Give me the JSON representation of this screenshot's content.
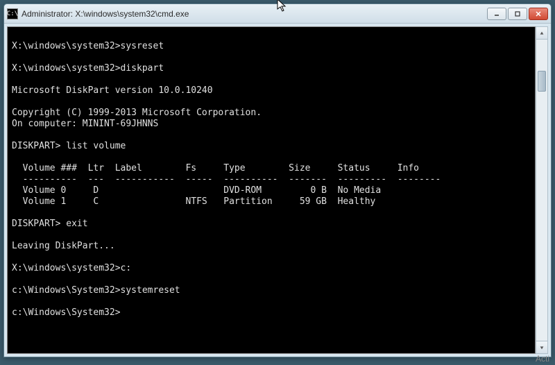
{
  "window": {
    "title": "Administrator: X:\\windows\\system32\\cmd.exe",
    "icon_label": "C:\\"
  },
  "console": {
    "lines": [
      "",
      "X:\\windows\\system32>sysreset",
      "",
      "X:\\windows\\system32>diskpart",
      "",
      "Microsoft DiskPart version 10.0.10240",
      "",
      "Copyright (C) 1999-2013 Microsoft Corporation.",
      "On computer: MININT-69JHNNS",
      "",
      "DISKPART> list volume",
      "",
      "  Volume ###  Ltr  Label        Fs     Type        Size     Status     Info",
      "  ----------  ---  -----------  -----  ----------  -------  ---------  --------",
      "  Volume 0     D                       DVD-ROM         0 B  No Media",
      "  Volume 1     C                NTFS   Partition     59 GB  Healthy",
      "",
      "DISKPART> exit",
      "",
      "Leaving DiskPart...",
      "",
      "X:\\windows\\system32>c:",
      "",
      "c:\\Windows\\System32>systemreset",
      "",
      "c:\\Windows\\System32>"
    ]
  },
  "watermark": "Acti"
}
